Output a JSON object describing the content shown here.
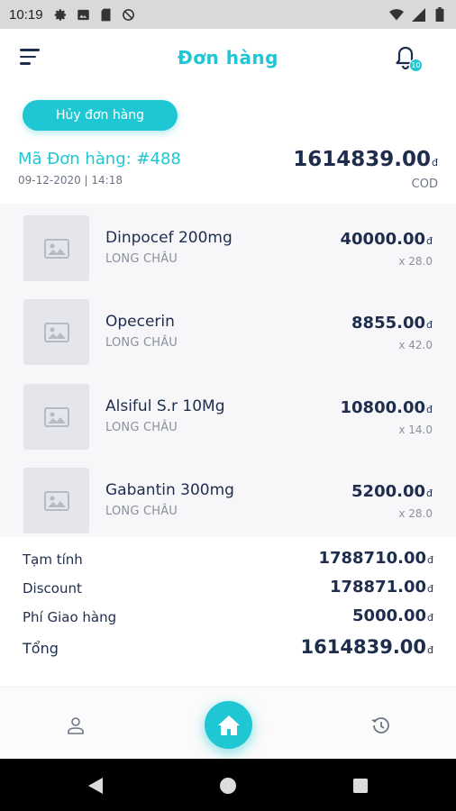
{
  "status_bar": {
    "time": "10:19"
  },
  "header": {
    "title": "Đơn hàng",
    "notification_count": "10"
  },
  "actions": {
    "cancel_label": "Hủy đơn hàng"
  },
  "order": {
    "code": "Mã Đơn hàng: #488",
    "date": "09-12-2020 | 14:18",
    "total": "1614839.00",
    "currency": "đ",
    "payment": "COD"
  },
  "items": [
    {
      "name": "Dinpocef 200mg",
      "brand": "LONG CHÂU",
      "price": "40000.00",
      "qty": "x 28.0"
    },
    {
      "name": "Opecerin",
      "brand": "LONG CHÂU",
      "price": "8855.00",
      "qty": "x 42.0"
    },
    {
      "name": "Alsiful S.r 10Mg",
      "brand": "LONG CHÂU",
      "price": "10800.00",
      "qty": "x 14.0"
    },
    {
      "name": "Gabantin 300mg",
      "brand": "LONG CHÂU",
      "price": "5200.00",
      "qty": "x 28.0"
    }
  ],
  "summary": {
    "subtotal_label": "Tạm tính",
    "subtotal": "1788710.00",
    "discount_label": "Discount",
    "discount": "178871.00",
    "shipping_label": "Phí Giao hàng",
    "shipping": "5000.00",
    "total_label": "Tổng",
    "total": "1614839.00"
  },
  "colors": {
    "accent": "#1fc7d4",
    "text": "#1f2d4d",
    "muted": "#8a909c"
  },
  "icons": [
    "settings-icon",
    "photo-icon",
    "sd-card-icon",
    "do-not-disturb-icon",
    "wifi-icon",
    "battery-icon",
    "menu-icon",
    "bell-icon",
    "image-placeholder-icon",
    "user-icon",
    "home-icon",
    "history-icon",
    "back-icon",
    "home-circle-icon",
    "recents-icon"
  ]
}
